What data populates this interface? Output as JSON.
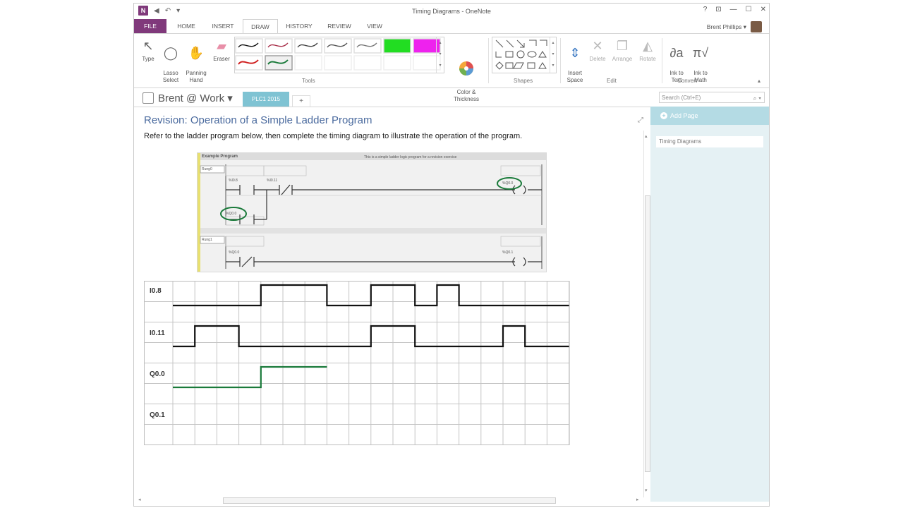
{
  "window": {
    "title": "Timing Diagrams - OneNote"
  },
  "quick_access": {
    "logo": "N",
    "back": "◀",
    "undo": "↶",
    "dropdown": "▾"
  },
  "window_controls": {
    "help": "?",
    "restore_ribbon": "⊡",
    "minimize": "—",
    "maximize": "☐",
    "close": "✕"
  },
  "user": {
    "name": "Brent Phillips ▾"
  },
  "tabs": [
    "FILE",
    "HOME",
    "INSERT",
    "DRAW",
    "HISTORY",
    "REVIEW",
    "VIEW"
  ],
  "ribbon": {
    "type": "Type",
    "lasso": "Lasso\nSelect",
    "panning": "Panning\nHand",
    "eraser": "Eraser",
    "color_thickness": "Color &\nThickness",
    "insert_space": "Insert\nSpace",
    "delete": "Delete",
    "arrange": "Arrange",
    "rotate": "Rotate",
    "ink_to_text": "Ink to\nText",
    "ink_to_math": "Ink to\nMath",
    "groups": {
      "tools": "Tools",
      "shapes": "Shapes",
      "edit": "Edit",
      "convert": "Convert"
    },
    "collapse": "▴"
  },
  "notebook": {
    "name": "Brent @ Work ▾",
    "section": "PLC1 2015",
    "add_tab": "+"
  },
  "search": {
    "placeholder": "Search (Ctrl+E)",
    "icon": "⌕ ▾"
  },
  "page_pane": {
    "add_page": "Add Page",
    "plus": "+",
    "pages": [
      "Timing Diagrams"
    ]
  },
  "page": {
    "title": "Revision: Operation of a Simple Ladder Program",
    "body": "Refer to the ladder program below, then complete the timing diagram to illustrate the operation of the program."
  },
  "ladder": {
    "header": "Example Program",
    "description": "This is a simple ladder logic program for a revision exercise",
    "rung0": "Rung0",
    "rung1": "Rung1",
    "contact_i8": "%I0.8",
    "contact_i11": "%I0.11",
    "coil_q0": "%Q0.0",
    "contact_q0": "%Q0.0",
    "contact_q0_r1": "%Q0.0",
    "coil_q1": "%Q0.1"
  },
  "timing": {
    "signals": [
      "I0.8",
      "I0.11",
      "Q0.0",
      "Q0.1"
    ],
    "states": {
      "I0.8": [
        0,
        0,
        0,
        0,
        1,
        1,
        1,
        0,
        0,
        1,
        1,
        0,
        1,
        0,
        0,
        0,
        0,
        0
      ],
      "I0.11": [
        0,
        1,
        1,
        0,
        0,
        0,
        0,
        0,
        0,
        1,
        1,
        0,
        0,
        0,
        0,
        1,
        0,
        0
      ],
      "Q0.0_drawn": [
        0,
        0,
        0,
        0,
        1,
        1,
        1
      ]
    },
    "ink_color": "#1a7a3a"
  },
  "colors": {
    "onenote_purple": "#80397b",
    "section_teal": "#7fc3d3",
    "pane_bg": "#e5f1f4",
    "title_blue": "#4a6a9e",
    "ink_green": "#1a7a3a"
  }
}
